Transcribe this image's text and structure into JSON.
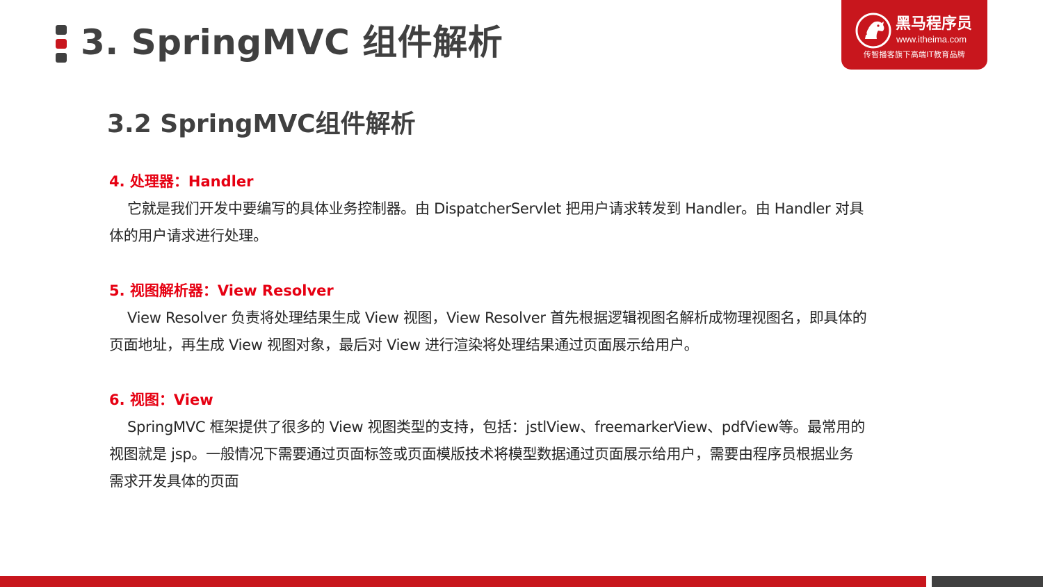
{
  "header": {
    "title": "3. SpringMVC 组件解析"
  },
  "logo": {
    "brand": "黑马程序员",
    "url": "www.itheima.com",
    "slogan": "传智播客旗下高端IT教育品牌",
    "icon": "horse-head-icon"
  },
  "section": {
    "subtitle": "3.2 SpringMVC组件解析"
  },
  "items": [
    {
      "heading": "4. 处理器：Handler",
      "body": "它就是我们开发中要编写的具体业务控制器。由 DispatcherServlet 把用户请求转发到 Handler。由 Handler 对具体的用户请求进行处理。"
    },
    {
      "heading": "5. 视图解析器：View Resolver",
      "body": "View Resolver 负责将处理结果生成 View 视图，View Resolver 首先根据逻辑视图名解析成物理视图名，即具体的页面地址，再生成 View 视图对象，最后对 View 进行渲染将处理结果通过页面展示给用户。"
    },
    {
      "heading": "6. 视图：View",
      "body": "SpringMVC 框架提供了很多的 View 视图类型的支持，包括：jstlView、freemarkerView、pdfView等。最常用的视图就是 jsp。一般情况下需要通过页面标签或页面模版技术将模型数据通过页面展示给用户，需要由程序员根据业务需求开发具体的页面"
    }
  ],
  "colors": {
    "brand_red": "#c8161d",
    "heading_red": "#e60012",
    "title_gray": "#404040",
    "body_text": "#262626"
  }
}
